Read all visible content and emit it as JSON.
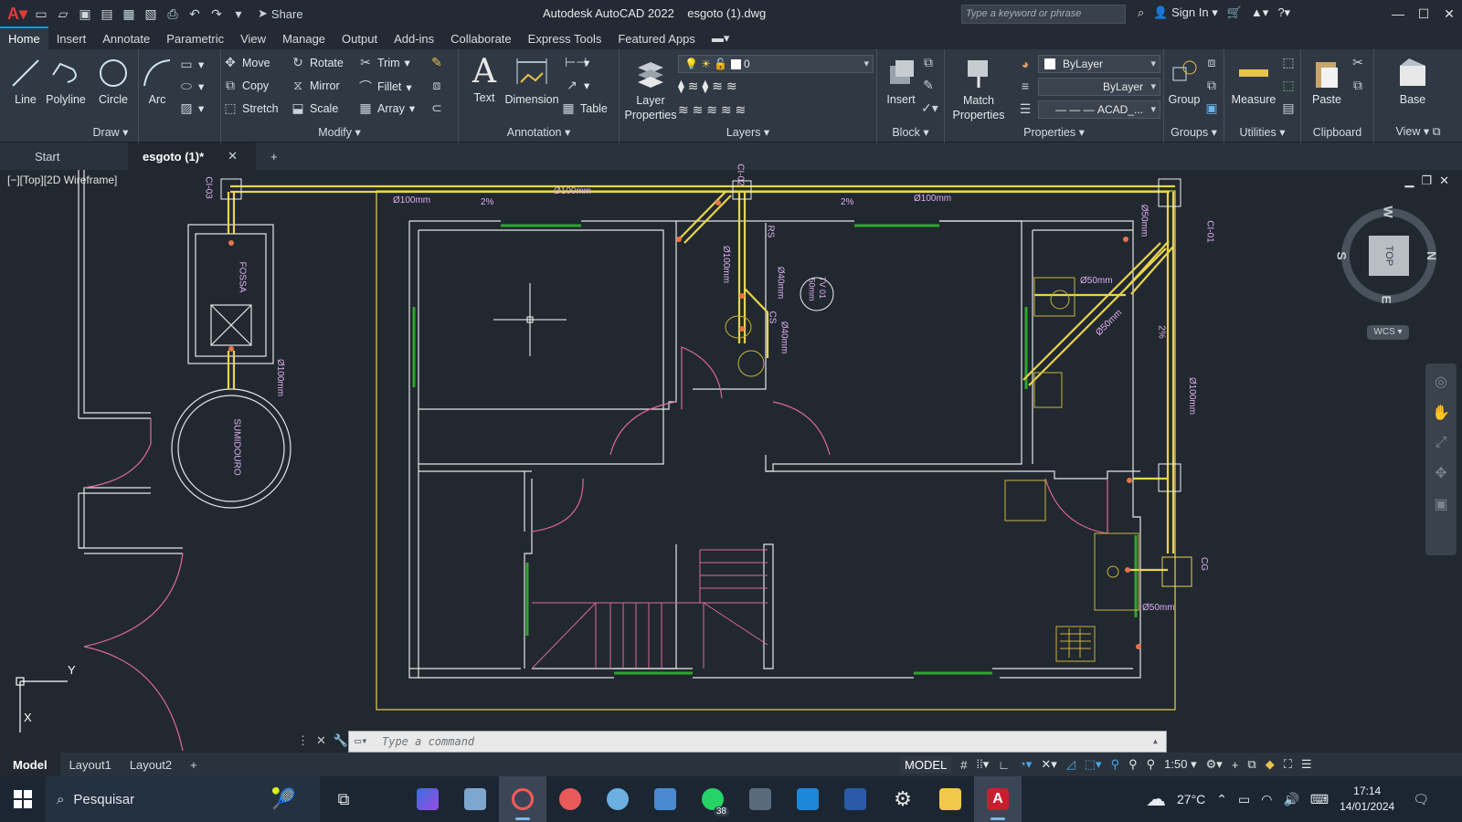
{
  "titlebar": {
    "share_label": "Share",
    "title": "Autodesk AutoCAD 2022    esgoto (1).dwg",
    "search_placeholder": "Type a keyword or phrase",
    "sign_in": "Sign In"
  },
  "ribbon_tabs": [
    "Home",
    "Insert",
    "Annotate",
    "Parametric",
    "View",
    "Manage",
    "Output",
    "Add-ins",
    "Collaborate",
    "Express Tools",
    "Featured Apps"
  ],
  "panels": {
    "draw": {
      "title": "Draw",
      "line": "Line",
      "polyline": "Polyline",
      "circle": "Circle",
      "arc": "Arc"
    },
    "modify": {
      "title": "Modify",
      "move": "Move",
      "rotate": "Rotate",
      "trim": "Trim",
      "copy": "Copy",
      "mirror": "Mirror",
      "fillet": "Fillet",
      "stretch": "Stretch",
      "scale": "Scale",
      "array": "Array"
    },
    "annotation": {
      "title": "Annotation",
      "text": "Text",
      "dimension": "Dimension",
      "table": "Table"
    },
    "layers": {
      "title": "Layers",
      "layer_properties": "Layer Properties",
      "current_layer": "0"
    },
    "block": {
      "title": "Block",
      "insert": "Insert"
    },
    "properties": {
      "title": "Properties",
      "match": "Match Properties",
      "color": "ByLayer",
      "lineweight": "ByLayer",
      "linetype": "ACAD_..."
    },
    "groups": {
      "title": "Groups",
      "group": "Group"
    },
    "utilities": {
      "title": "Utilities",
      "measure": "Measure"
    },
    "clipboard": {
      "title": "Clipboard",
      "paste": "Paste"
    },
    "view": {
      "title": "View",
      "base": "Base"
    }
  },
  "doc_tabs": {
    "start": "Start",
    "active": "esgoto (1)*"
  },
  "viewport": {
    "label": "[−][Top][2D Wireframe]",
    "viewcube": {
      "top": "TOP",
      "n": "N",
      "s": "S",
      "e": "E",
      "w": "W",
      "wcs": "WCS"
    },
    "labels": {
      "fossa": "FOSSA",
      "sumidouro": "SUMIDOURO",
      "ci03": "CI-03",
      "ci02": "CI-02",
      "ci01": "CI-01",
      "cg": "CG",
      "cs": "CS",
      "rs": "RS",
      "tv": "TV 01",
      "tv_d": "50mm",
      "d100_a": "Ø100mm",
      "d100_b": "Ø100mm",
      "d100_c": "Ø100mm",
      "d100_v1": "Ø100mm",
      "d100_v2": "Ø100mm",
      "d100_v3": "Ø100mm",
      "d50_a": "Ø50mm",
      "d50_b": "Ø50mm",
      "d50_c": "Ø50mm",
      "d50_v": "Ø50mm",
      "d40_a": "Ø40mm",
      "d40_b": "Ø40mm",
      "slope": "2%"
    },
    "ucs_y": "Y",
    "ucs_x": "X"
  },
  "command": {
    "placeholder": "Type a command"
  },
  "status": {
    "model_tab": "Model",
    "layout1": "Layout1",
    "layout2": "Layout2",
    "model_btn": "MODEL",
    "scale": "1:50"
  },
  "taskbar": {
    "search": "Pesquisar",
    "whatsapp_badge": "38",
    "temperature": "27°C",
    "time": "17:14",
    "date": "14/01/2024"
  },
  "colors": {
    "accent": "#0d9cdb",
    "yellow": "#e8d44d",
    "pink": "#e0679a",
    "green": "#2fa52f",
    "white_lines": "#e6e6e6"
  }
}
